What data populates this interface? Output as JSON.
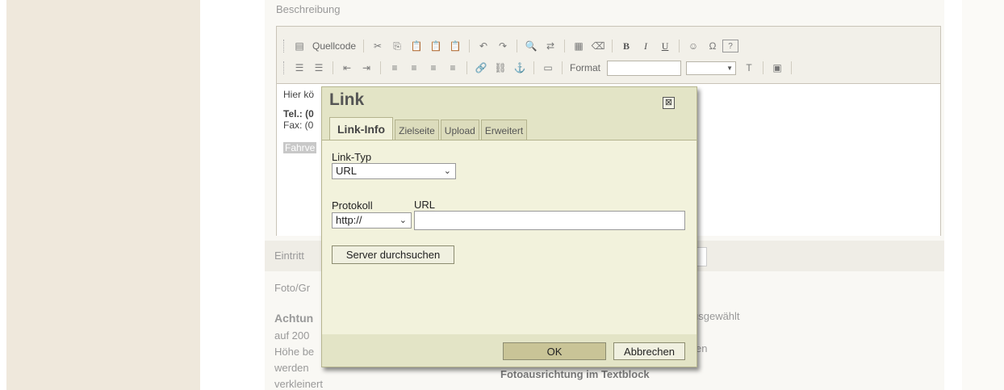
{
  "page": {
    "description_label": "Beschreibung",
    "editor_lines": [
      "Hier kö",
      "Tel.: (0",
      "Fax: (0",
      "Fahrve"
    ],
    "eintritt_label": "Eintritt",
    "foto_label": "Foto/Gr",
    "left_col_lines": [
      "Achtun",
      "auf 200",
      "Höhe be",
      "werden",
      "verkleinert"
    ],
    "right_col_lines": [
      "usgewählt",
      "en",
      "Fotoausrichtung im Textblock"
    ]
  },
  "toolbar": {
    "source_label": "Quellcode",
    "format_label": "Format",
    "row1_icons": [
      "cut-icon",
      "copy-icon",
      "paste-icon",
      "paste-text-icon",
      "paste-word-icon",
      "undo-icon",
      "redo-icon",
      "find-icon",
      "replace-icon",
      "select-all-icon",
      "remove-format-icon",
      "bold-icon",
      "italic-icon",
      "underline-icon",
      "smiley-icon",
      "special-char-icon",
      "help-icon"
    ],
    "row1_glyphs": {
      "bold": "B",
      "italic": "I",
      "underline": "U",
      "help": "?"
    },
    "row2_icons": [
      "ordered-list-icon",
      "bullet-list-icon",
      "outdent-icon",
      "indent-icon",
      "align-left-icon",
      "align-center-icon",
      "align-right-icon",
      "justify-icon",
      "link-icon",
      "unlink-icon",
      "anchor-icon",
      "table-icon",
      "text-color-icon",
      "maximize-icon"
    ]
  },
  "dialog": {
    "title": "Link",
    "close_glyph": "⊠",
    "tabs": [
      "Link-Info",
      "Zielseite",
      "Upload",
      "Erweitert"
    ],
    "link_type_label": "Link-Typ",
    "link_type_value": "URL",
    "protocol_label": "Protokoll",
    "protocol_value": "http://",
    "url_label": "URL",
    "url_value": "",
    "browse_button": "Server durchsuchen",
    "ok_button": "OK",
    "cancel_button": "Abbrechen"
  }
}
